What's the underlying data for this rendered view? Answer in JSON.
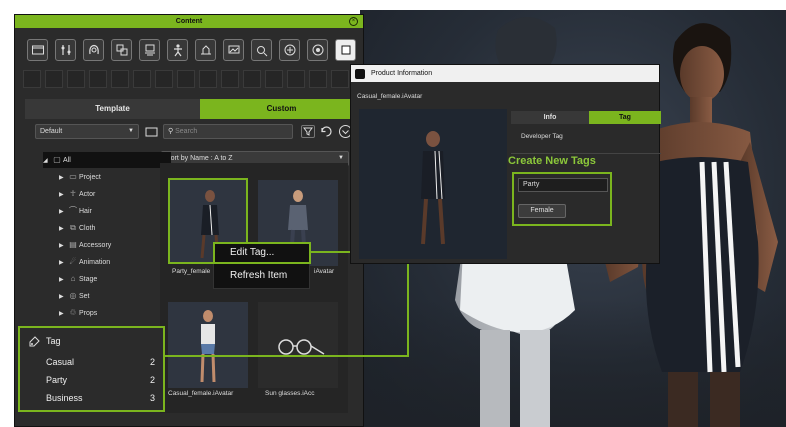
{
  "colors": {
    "accent": "#7bb51e",
    "panel": "#2b2b2b",
    "dark": "#111111"
  },
  "content_panel": {
    "title": "Content",
    "close_icon": "close-icon",
    "toolbar_icons": [
      "folder-icon",
      "settings-icon",
      "hair-icon",
      "cloth-icon",
      "accessory-icon",
      "actor-icon",
      "stage-icon",
      "set-icon",
      "props-icon",
      "scene-icon",
      "white-square-icon"
    ],
    "tabs": {
      "template": "Template",
      "custom": "Custom"
    },
    "filter": {
      "dropdown_value": "Default",
      "search_placeholder": "Search",
      "sort_value": "Sort by Name : A to Z"
    },
    "tree": [
      {
        "label": "All",
        "icon": "all-icon"
      },
      {
        "label": "Project",
        "icon": "project-icon"
      },
      {
        "label": "Actor",
        "icon": "actor-icon"
      },
      {
        "label": "Hair",
        "icon": "hair-icon"
      },
      {
        "label": "Cloth",
        "icon": "cloth-icon"
      },
      {
        "label": "Accessory",
        "icon": "accessory-icon"
      },
      {
        "label": "Animation",
        "icon": "animation-icon"
      },
      {
        "label": "Stage",
        "icon": "stage-icon"
      },
      {
        "label": "Set",
        "icon": "set-icon"
      },
      {
        "label": "Props",
        "icon": "props-icon"
      }
    ],
    "items": [
      {
        "label": "Party_female"
      },
      {
        "label": "iAvatar"
      },
      {
        "label": "Casual_female.iAvatar"
      },
      {
        "label": "Sun glasses.iAcc"
      }
    ]
  },
  "context_menu": {
    "edit_tag": "Edit Tag...",
    "refresh": "Refresh Item"
  },
  "tag_panel": {
    "title": "Tag",
    "rows": [
      {
        "label": "Casual",
        "count": "2"
      },
      {
        "label": "Party",
        "count": "2"
      },
      {
        "label": "Business",
        "count": "3"
      }
    ]
  },
  "product_info": {
    "title": "Product Information",
    "subtitle": "Casual_female.iAvatar",
    "tabs": {
      "info": "Info",
      "tag": "Tag"
    },
    "developer_tag": "Developer Tag",
    "create_new_tags": "Create New Tags",
    "input_value": "Party",
    "chip": "Female"
  }
}
